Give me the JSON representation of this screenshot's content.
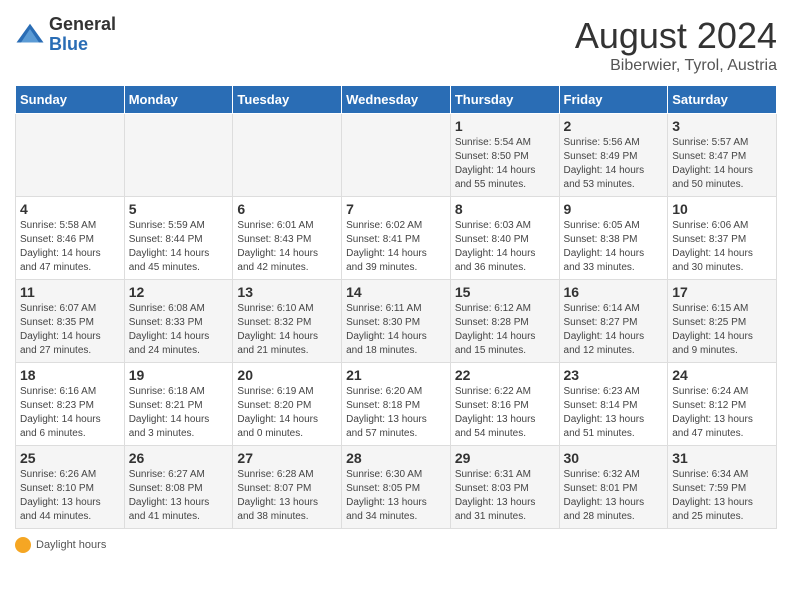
{
  "header": {
    "logo_general": "General",
    "logo_blue": "Blue",
    "month_title": "August 2024",
    "location": "Biberwier, Tyrol, Austria"
  },
  "days_of_week": [
    "Sunday",
    "Monday",
    "Tuesday",
    "Wednesday",
    "Thursday",
    "Friday",
    "Saturday"
  ],
  "weeks": [
    [
      {
        "day": "",
        "info": ""
      },
      {
        "day": "",
        "info": ""
      },
      {
        "day": "",
        "info": ""
      },
      {
        "day": "",
        "info": ""
      },
      {
        "day": "1",
        "info": "Sunrise: 5:54 AM\nSunset: 8:50 PM\nDaylight: 14 hours\nand 55 minutes."
      },
      {
        "day": "2",
        "info": "Sunrise: 5:56 AM\nSunset: 8:49 PM\nDaylight: 14 hours\nand 53 minutes."
      },
      {
        "day": "3",
        "info": "Sunrise: 5:57 AM\nSunset: 8:47 PM\nDaylight: 14 hours\nand 50 minutes."
      }
    ],
    [
      {
        "day": "4",
        "info": "Sunrise: 5:58 AM\nSunset: 8:46 PM\nDaylight: 14 hours\nand 47 minutes."
      },
      {
        "day": "5",
        "info": "Sunrise: 5:59 AM\nSunset: 8:44 PM\nDaylight: 14 hours\nand 45 minutes."
      },
      {
        "day": "6",
        "info": "Sunrise: 6:01 AM\nSunset: 8:43 PM\nDaylight: 14 hours\nand 42 minutes."
      },
      {
        "day": "7",
        "info": "Sunrise: 6:02 AM\nSunset: 8:41 PM\nDaylight: 14 hours\nand 39 minutes."
      },
      {
        "day": "8",
        "info": "Sunrise: 6:03 AM\nSunset: 8:40 PM\nDaylight: 14 hours\nand 36 minutes."
      },
      {
        "day": "9",
        "info": "Sunrise: 6:05 AM\nSunset: 8:38 PM\nDaylight: 14 hours\nand 33 minutes."
      },
      {
        "day": "10",
        "info": "Sunrise: 6:06 AM\nSunset: 8:37 PM\nDaylight: 14 hours\nand 30 minutes."
      }
    ],
    [
      {
        "day": "11",
        "info": "Sunrise: 6:07 AM\nSunset: 8:35 PM\nDaylight: 14 hours\nand 27 minutes."
      },
      {
        "day": "12",
        "info": "Sunrise: 6:08 AM\nSunset: 8:33 PM\nDaylight: 14 hours\nand 24 minutes."
      },
      {
        "day": "13",
        "info": "Sunrise: 6:10 AM\nSunset: 8:32 PM\nDaylight: 14 hours\nand 21 minutes."
      },
      {
        "day": "14",
        "info": "Sunrise: 6:11 AM\nSunset: 8:30 PM\nDaylight: 14 hours\nand 18 minutes."
      },
      {
        "day": "15",
        "info": "Sunrise: 6:12 AM\nSunset: 8:28 PM\nDaylight: 14 hours\nand 15 minutes."
      },
      {
        "day": "16",
        "info": "Sunrise: 6:14 AM\nSunset: 8:27 PM\nDaylight: 14 hours\nand 12 minutes."
      },
      {
        "day": "17",
        "info": "Sunrise: 6:15 AM\nSunset: 8:25 PM\nDaylight: 14 hours\nand 9 minutes."
      }
    ],
    [
      {
        "day": "18",
        "info": "Sunrise: 6:16 AM\nSunset: 8:23 PM\nDaylight: 14 hours\nand 6 minutes."
      },
      {
        "day": "19",
        "info": "Sunrise: 6:18 AM\nSunset: 8:21 PM\nDaylight: 14 hours\nand 3 minutes."
      },
      {
        "day": "20",
        "info": "Sunrise: 6:19 AM\nSunset: 8:20 PM\nDaylight: 14 hours\nand 0 minutes."
      },
      {
        "day": "21",
        "info": "Sunrise: 6:20 AM\nSunset: 8:18 PM\nDaylight: 13 hours\nand 57 minutes."
      },
      {
        "day": "22",
        "info": "Sunrise: 6:22 AM\nSunset: 8:16 PM\nDaylight: 13 hours\nand 54 minutes."
      },
      {
        "day": "23",
        "info": "Sunrise: 6:23 AM\nSunset: 8:14 PM\nDaylight: 13 hours\nand 51 minutes."
      },
      {
        "day": "24",
        "info": "Sunrise: 6:24 AM\nSunset: 8:12 PM\nDaylight: 13 hours\nand 47 minutes."
      }
    ],
    [
      {
        "day": "25",
        "info": "Sunrise: 6:26 AM\nSunset: 8:10 PM\nDaylight: 13 hours\nand 44 minutes."
      },
      {
        "day": "26",
        "info": "Sunrise: 6:27 AM\nSunset: 8:08 PM\nDaylight: 13 hours\nand 41 minutes."
      },
      {
        "day": "27",
        "info": "Sunrise: 6:28 AM\nSunset: 8:07 PM\nDaylight: 13 hours\nand 38 minutes."
      },
      {
        "day": "28",
        "info": "Sunrise: 6:30 AM\nSunset: 8:05 PM\nDaylight: 13 hours\nand 34 minutes."
      },
      {
        "day": "29",
        "info": "Sunrise: 6:31 AM\nSunset: 8:03 PM\nDaylight: 13 hours\nand 31 minutes."
      },
      {
        "day": "30",
        "info": "Sunrise: 6:32 AM\nSunset: 8:01 PM\nDaylight: 13 hours\nand 28 minutes."
      },
      {
        "day": "31",
        "info": "Sunrise: 6:34 AM\nSunset: 7:59 PM\nDaylight: 13 hours\nand 25 minutes."
      }
    ]
  ],
  "footer": {
    "daylight_label": "Daylight hours"
  }
}
